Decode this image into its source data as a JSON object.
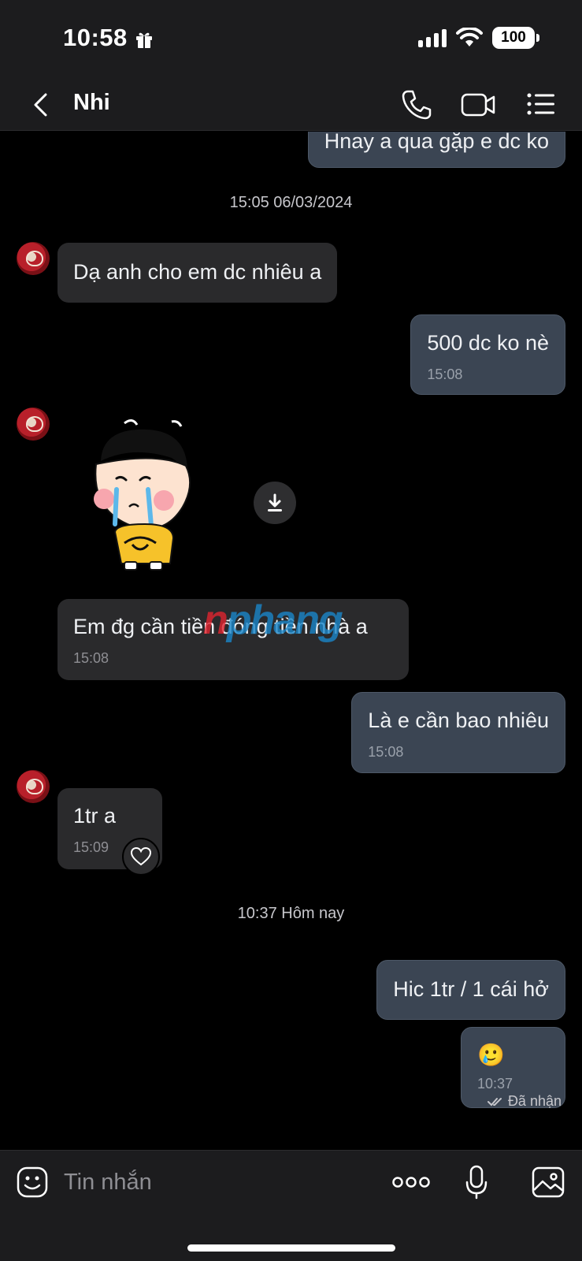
{
  "status_bar": {
    "time": "10:58",
    "battery": "100"
  },
  "header": {
    "contact_name": "Nhi",
    "icons": [
      "back-chevron-icon",
      "phone-icon",
      "video-call-icon",
      "menu-list-icon"
    ]
  },
  "chat": {
    "messages": [
      {
        "direction": "out",
        "text": "Hnay a qua gặp e dc ko"
      },
      {
        "type": "date",
        "text": "15:05 06/03/2024"
      },
      {
        "direction": "in",
        "text": "Dạ anh cho em dc nhiêu a"
      },
      {
        "direction": "out",
        "text": "500 dc ko nè",
        "time": "15:08"
      },
      {
        "direction": "in",
        "type": "sticker",
        "sticker": "crying-child-sticker"
      },
      {
        "direction": "in",
        "text": "Em đg cần tiền đóng tiền nhà a",
        "time": "15:08"
      },
      {
        "direction": "out",
        "text": "Là e cần bao nhiêu",
        "time": "15:08"
      },
      {
        "direction": "in",
        "text": "1tr a",
        "time": "15:09"
      },
      {
        "type": "date",
        "text": "10:37 Hôm nay"
      },
      {
        "direction": "out",
        "text": "Hic 1tr / 1 cái hở"
      },
      {
        "direction": "out",
        "text": "🥲",
        "time": "10:37"
      }
    ],
    "receipt": "Đã nhận",
    "watermark": {
      "part1": "n",
      "part2": "phang"
    }
  },
  "input_bar": {
    "placeholder": "Tin nhắn",
    "icons": [
      "emoji-icon",
      "more-options-icon",
      "microphone-icon",
      "image-gallery-icon"
    ]
  },
  "colors": {
    "background": "#000000",
    "bar": "#1c1c1e",
    "outgoing_bubble": "#3b4553",
    "incoming_bubble": "#2a2a2c"
  }
}
